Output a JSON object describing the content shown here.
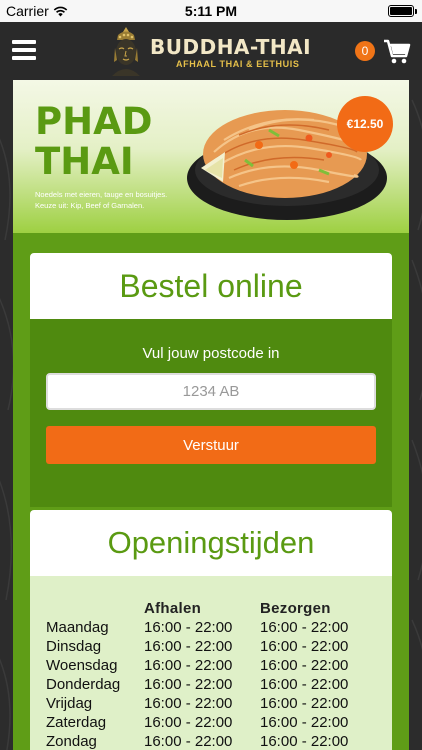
{
  "status_bar": {
    "carrier": "Carrier",
    "time": "5:11 PM"
  },
  "header": {
    "brand_name": "BUDDHA-THAI",
    "brand_tagline": "AFHAAL THAI & EETHUIS",
    "cart_count": "0",
    "icons": [
      "menu-icon",
      "buddha-logo",
      "cart-icon"
    ]
  },
  "hero": {
    "title_line1": "PHAD",
    "title_line2": "THAI",
    "description_line1": "Noedels met eieren, tauge en bosuitjes.",
    "description_line2": "Keuze uit: Kip, Beef of Garnalen.",
    "price": "€12.50"
  },
  "order": {
    "heading": "Bestel online",
    "postcode_label": "Vul jouw postcode in",
    "postcode_placeholder": "1234 AB",
    "postcode_value": "",
    "submit_label": "Verstuur"
  },
  "hours": {
    "heading": "Openingstijden",
    "columns": [
      "",
      "Afhalen",
      "Bezorgen"
    ],
    "rows": [
      {
        "day": "Maandag",
        "pickup": "16:00 - 22:00",
        "delivery": "16:00 - 22:00"
      },
      {
        "day": "Dinsdag",
        "pickup": "16:00 - 22:00",
        "delivery": "16:00 - 22:00"
      },
      {
        "day": "Woensdag",
        "pickup": "16:00 - 22:00",
        "delivery": "16:00 - 22:00"
      },
      {
        "day": "Donderdag",
        "pickup": "16:00 - 22:00",
        "delivery": "16:00 - 22:00"
      },
      {
        "day": "Vrijdag",
        "pickup": "16:00 - 22:00",
        "delivery": "16:00 - 22:00"
      },
      {
        "day": "Zaterdag",
        "pickup": "16:00 - 22:00",
        "delivery": "16:00 - 22:00"
      },
      {
        "day": "Zondag",
        "pickup": "16:00 - 22:00",
        "delivery": "16:00 - 22:00"
      }
    ]
  },
  "colors": {
    "brand_green": "#5a9a12",
    "accent_orange": "#f26b16",
    "header_bg": "#2a2a2a"
  }
}
